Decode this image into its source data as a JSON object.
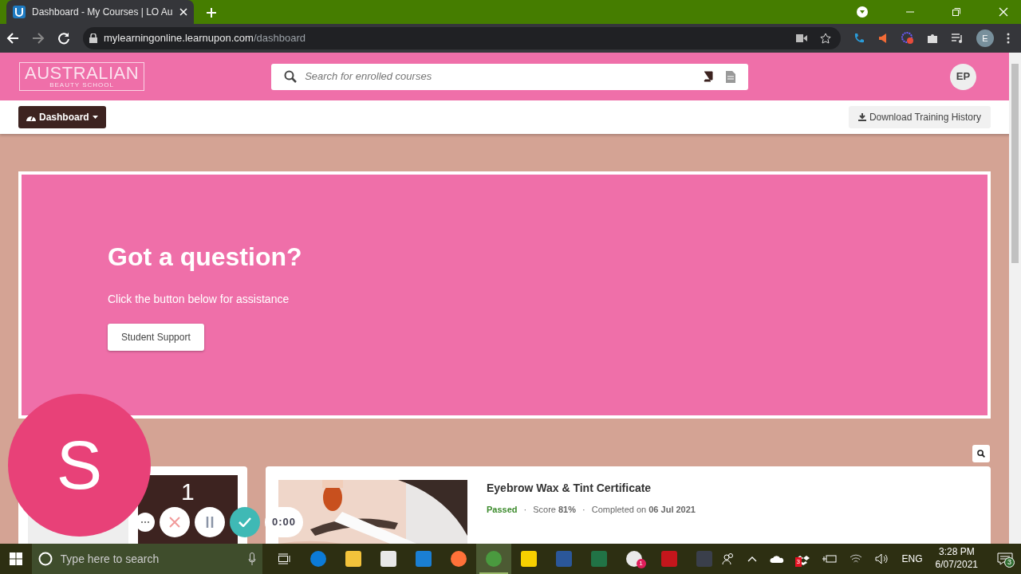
{
  "browser": {
    "tab_title": "Dashboard - My Courses | LO Au",
    "url_host": "mylearningonline.learnupon.com",
    "url_path": "/dashboard",
    "profile": "E"
  },
  "header": {
    "logo_title": "AUSTRALIAN",
    "logo_subtitle": "BEAUTY SCHOOL",
    "search": {
      "placeholder": "Search for enrolled courses"
    },
    "avatar": "EP"
  },
  "subnav": {
    "menu": "Dashboard",
    "download": "Download Training History"
  },
  "hero": {
    "title": "Got a question?",
    "text": "Click the button below for assistance",
    "button": "Student Support"
  },
  "stats": [
    {
      "kind": "light"
    },
    {
      "kind": "dark",
      "value": "1"
    }
  ],
  "course": {
    "title": "Eyebrow Wax & Tint Certificate",
    "status": "Passed",
    "separator": "·",
    "score": "Score **81%**",
    "separator_2": "·",
    "completed": "Completed on **06 Jul 2021**"
  },
  "recorder": {
    "letter": "S",
    "timer": "0:00"
  },
  "taskbar": {
    "search": {
      "placeholder": "Type here to search"
    },
    "apps": [
      {
        "color": "#0c7bd7",
        "selected": false
      },
      {
        "color": "#f3c33b",
        "selected": false
      },
      {
        "color": "#e8e8e8",
        "selected": false
      },
      {
        "color": "#1a7fd4",
        "selected": false
      },
      {
        "color": "#ff7139",
        "selected": false
      },
      {
        "color": "#4a9a3f",
        "selected": true
      },
      {
        "color": "#f7d000",
        "selected": false
      },
      {
        "color": "#2b579a",
        "selected": false
      },
      {
        "color": "#217346",
        "selected": false
      },
      {
        "color": "#e9e9e9",
        "selected": false,
        "badge": "1"
      },
      {
        "color": "#c4161c",
        "selected": false
      },
      {
        "color": "#3a3f4b",
        "selected": false
      }
    ],
    "dropbox_badge": "3",
    "language": "ENG",
    "time": "3:28 PM",
    "date": "6/07/2021",
    "notifications": "3"
  }
}
